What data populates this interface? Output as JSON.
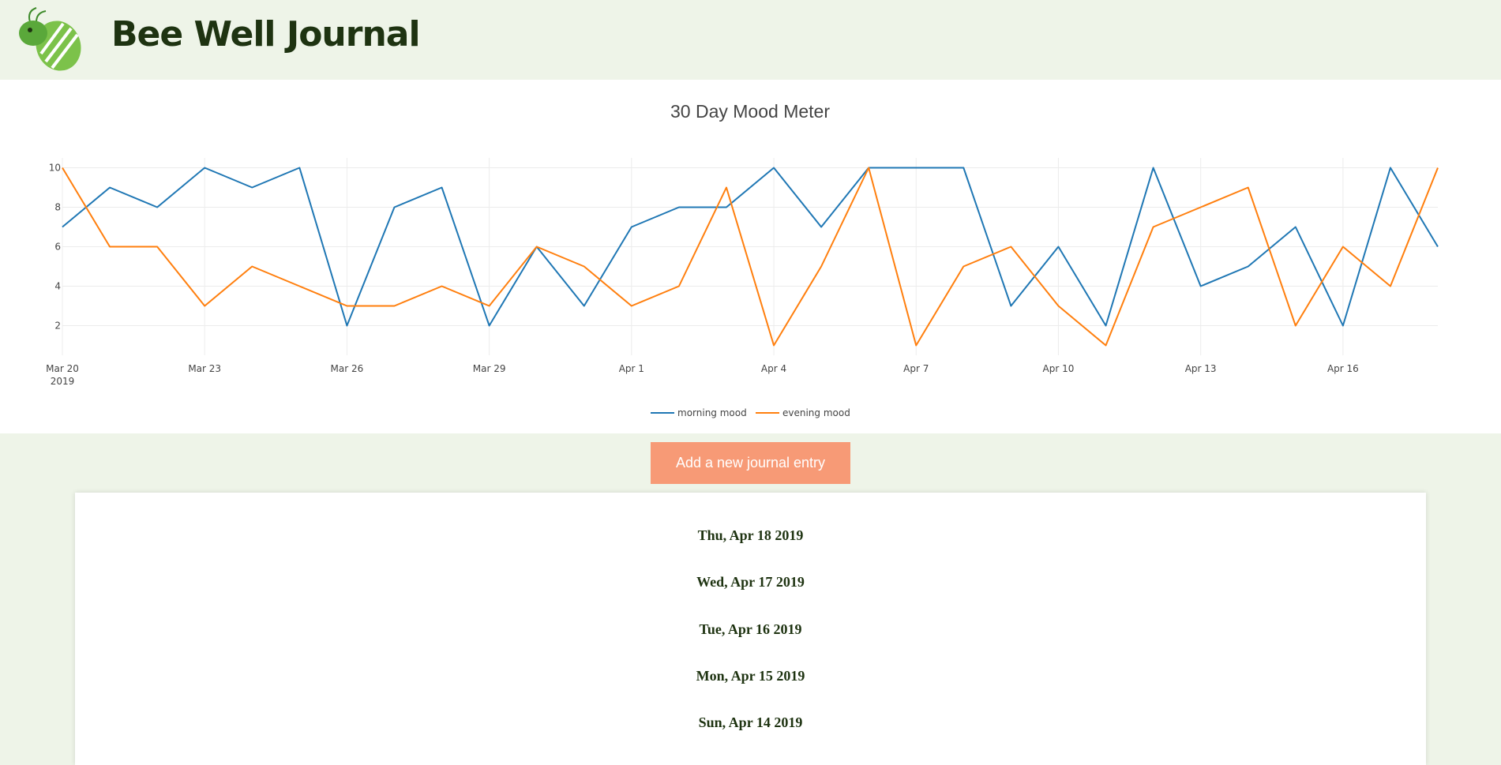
{
  "app": {
    "title": "Bee Well Journal",
    "logo_icon": "bee-logo-icon",
    "header_bg": "#eef4e8",
    "title_color": "#1e3311"
  },
  "chart_data": {
    "type": "line",
    "title": "30 Day Mood Meter",
    "xlabel": "",
    "ylabel": "",
    "x": [
      "2019-03-20",
      "2019-03-21",
      "2019-03-22",
      "2019-03-23",
      "2019-03-24",
      "2019-03-25",
      "2019-03-26",
      "2019-03-27",
      "2019-03-28",
      "2019-03-29",
      "2019-03-30",
      "2019-03-31",
      "2019-04-01",
      "2019-04-02",
      "2019-04-03",
      "2019-04-04",
      "2019-04-05",
      "2019-04-06",
      "2019-04-07",
      "2019-04-08",
      "2019-04-09",
      "2019-04-10",
      "2019-04-11",
      "2019-04-12",
      "2019-04-13",
      "2019-04-14",
      "2019-04-15",
      "2019-04-16",
      "2019-04-17",
      "2019-04-18"
    ],
    "x_ticks": [
      {
        "date": "2019-03-20",
        "label": "Mar 20",
        "sublabel": "2019"
      },
      {
        "date": "2019-03-23",
        "label": "Mar 23"
      },
      {
        "date": "2019-03-26",
        "label": "Mar 26"
      },
      {
        "date": "2019-03-29",
        "label": "Mar 29"
      },
      {
        "date": "2019-04-01",
        "label": "Apr 1"
      },
      {
        "date": "2019-04-04",
        "label": "Apr 4"
      },
      {
        "date": "2019-04-07",
        "label": "Apr 7"
      },
      {
        "date": "2019-04-10",
        "label": "Apr 10"
      },
      {
        "date": "2019-04-13",
        "label": "Apr 13"
      },
      {
        "date": "2019-04-16",
        "label": "Apr 16"
      }
    ],
    "y_ticks": [
      2,
      4,
      6,
      8,
      10
    ],
    "ylim": [
      0.5,
      10.5
    ],
    "grid": true,
    "legend_position": "bottom-center",
    "series": [
      {
        "name": "morning mood",
        "color": "#1f77b4",
        "values": [
          7,
          9,
          8,
          10,
          9,
          10,
          2,
          8,
          9,
          2,
          6,
          3,
          7,
          8,
          8,
          10,
          7,
          10,
          10,
          10,
          3,
          6,
          2,
          10,
          4,
          5,
          7,
          2,
          10,
          6
        ]
      },
      {
        "name": "evening mood",
        "color": "#ff7f0e",
        "values": [
          10,
          6,
          6,
          3,
          5,
          4,
          3,
          3,
          4,
          3,
          6,
          5,
          3,
          4,
          9,
          1,
          5,
          10,
          1,
          5,
          6,
          3,
          1,
          7,
          8,
          9,
          2,
          6,
          4,
          10
        ]
      }
    ]
  },
  "actions": {
    "add_entry_label": "Add a new journal entry",
    "button_color": "#f79a76"
  },
  "entries": [
    {
      "date": "Thu, Apr 18 2019"
    },
    {
      "date": "Wed, Apr 17 2019"
    },
    {
      "date": "Tue, Apr 16 2019"
    },
    {
      "date": "Mon, Apr 15 2019"
    },
    {
      "date": "Sun, Apr 14 2019"
    }
  ]
}
